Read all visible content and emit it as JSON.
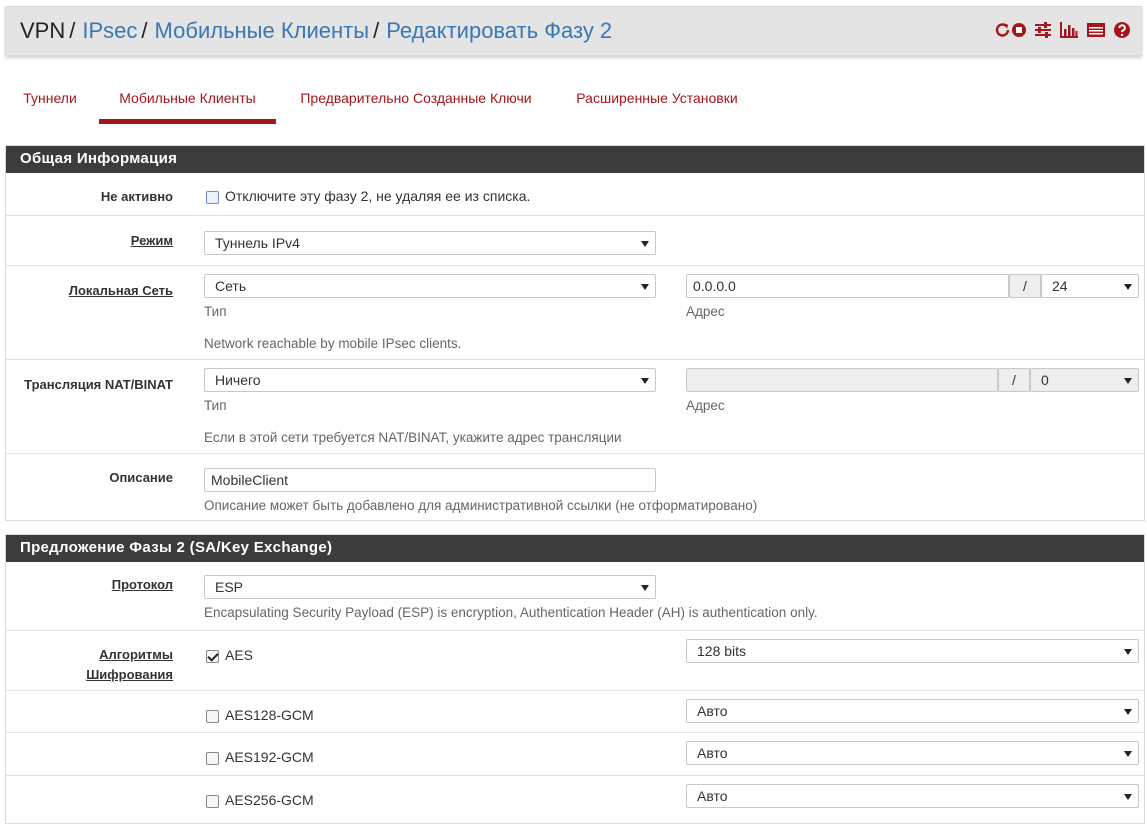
{
  "breadcrumb": {
    "root": "VPN",
    "items": [
      "IPsec",
      "Мобильные Клиенты",
      "Редактировать Фазу 2"
    ],
    "separator": "/"
  },
  "header_icons": [
    "reload-icon",
    "stop-icon",
    "sliders-icon",
    "bar-chart-icon",
    "list-icon",
    "help-icon"
  ],
  "accent_color": "#a4161b",
  "tabs": [
    {
      "label": "Туннели",
      "active": false
    },
    {
      "label": "Мобильные Клиенты",
      "active": true
    },
    {
      "label": "Предварительно Созданные Ключи",
      "active": false
    },
    {
      "label": "Расширенные Установки",
      "active": false
    }
  ],
  "general": {
    "title": "Общая Информация",
    "disabled": {
      "label": "Не активно",
      "text": "Отключите эту фазу 2, не удаляя ее из списка.",
      "checked": false
    },
    "mode": {
      "label": "Режим",
      "value": "Туннель IPv4"
    },
    "local_network": {
      "label": "Локальная Сеть",
      "type_value": "Сеть",
      "address_value": "0.0.0.0",
      "slash": "/",
      "mask_value": "24",
      "type_caption": "Тип",
      "address_caption": "Адрес",
      "help": "Network reachable by mobile IPsec clients."
    },
    "nat": {
      "label": "Трансляция NAT/BINAT",
      "type_value": "Ничего",
      "address_value": "",
      "slash": "/",
      "mask_value": "0",
      "type_caption": "Тип",
      "address_caption": "Адрес",
      "help": "Если в этой сети требуется NAT/BINAT, укажите адрес трансляции"
    },
    "description": {
      "label": "Описание",
      "value": "MobileClient",
      "help": "Описание может быть добавлено для административной ссылки (не отформатировано)"
    }
  },
  "phase2": {
    "title": "Предложение Фазы 2 (SA/Key Exchange)",
    "protocol": {
      "label": "Протокол",
      "value": "ESP",
      "help": "Encapsulating Security Payload (ESP) is encryption, Authentication Header (AH) is authentication only."
    },
    "algorithms": {
      "label": "Алгоритмы Шифрования",
      "items": [
        {
          "name": "AES",
          "checked": true,
          "keylen": "128 bits"
        },
        {
          "name": "AES128-GCM",
          "checked": false,
          "keylen": "Авто"
        },
        {
          "name": "AES192-GCM",
          "checked": false,
          "keylen": "Авто"
        },
        {
          "name": "AES256-GCM",
          "checked": false,
          "keylen": "Авто"
        }
      ]
    }
  }
}
